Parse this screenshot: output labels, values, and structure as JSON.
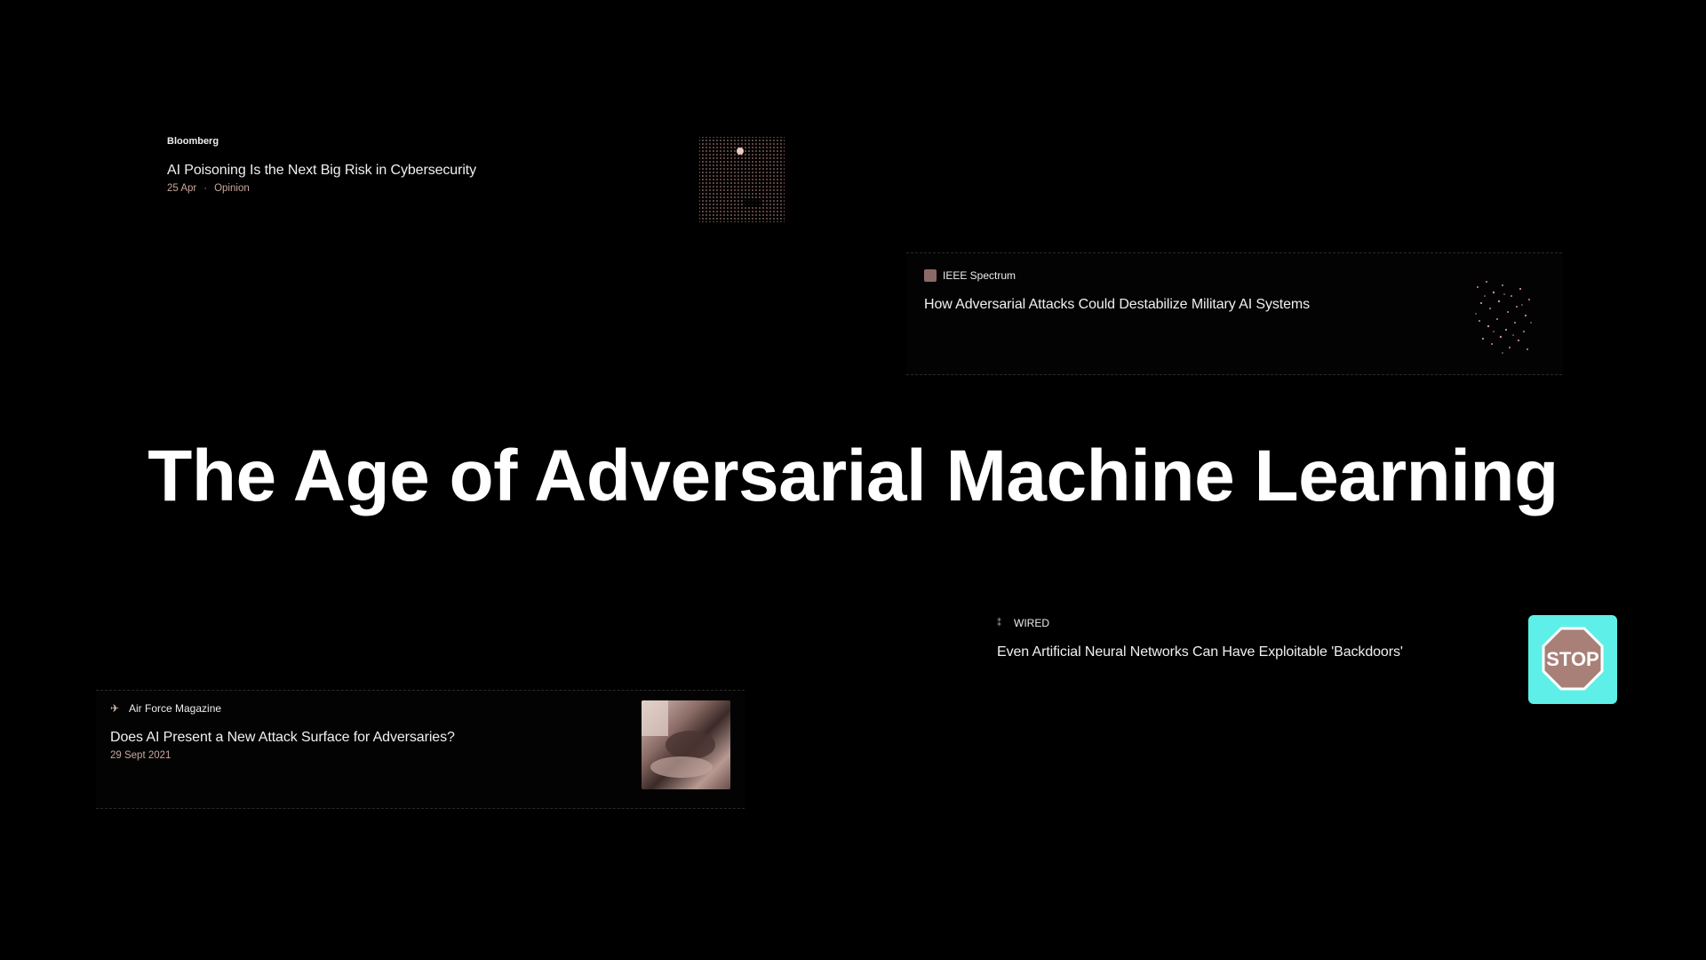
{
  "title": "The Age of Adversarial Machine Learning",
  "cards": {
    "bloomberg": {
      "source": "Bloomberg",
      "headline": "AI Poisoning Is the Next Big Risk in Cybersecurity",
      "date": "25 Apr",
      "separator": "·",
      "tag": "Opinion",
      "thumbnail": "dotted-grid-image"
    },
    "ieee": {
      "source": "IEEE Spectrum",
      "source_icon": "ieee-spectrum-icon",
      "headline": "How Adversarial Attacks Could Destabilize Military AI Systems",
      "thumbnail": "noise-particles-image"
    },
    "wired": {
      "source": "WIRED",
      "source_icon": "wired-icon",
      "headline": "Even Artificial Neural Networks Can Have Exploitable 'Backdoors'",
      "thumbnail": "stop-sign-image",
      "thumbnail_text": "STOP"
    },
    "airforce": {
      "source": "Air Force Magazine",
      "source_icon": "air-force-wings-icon",
      "headline": "Does AI Present a New Attack Surface for Adversaries?",
      "date": "29 Sept 2021",
      "thumbnail": "photo-thumbnail-image"
    }
  },
  "colors": {
    "background": "#000000",
    "meta_text": "#c9a79c",
    "stop_bg": "#5ef0e8",
    "stop_sign": "#a88078"
  }
}
